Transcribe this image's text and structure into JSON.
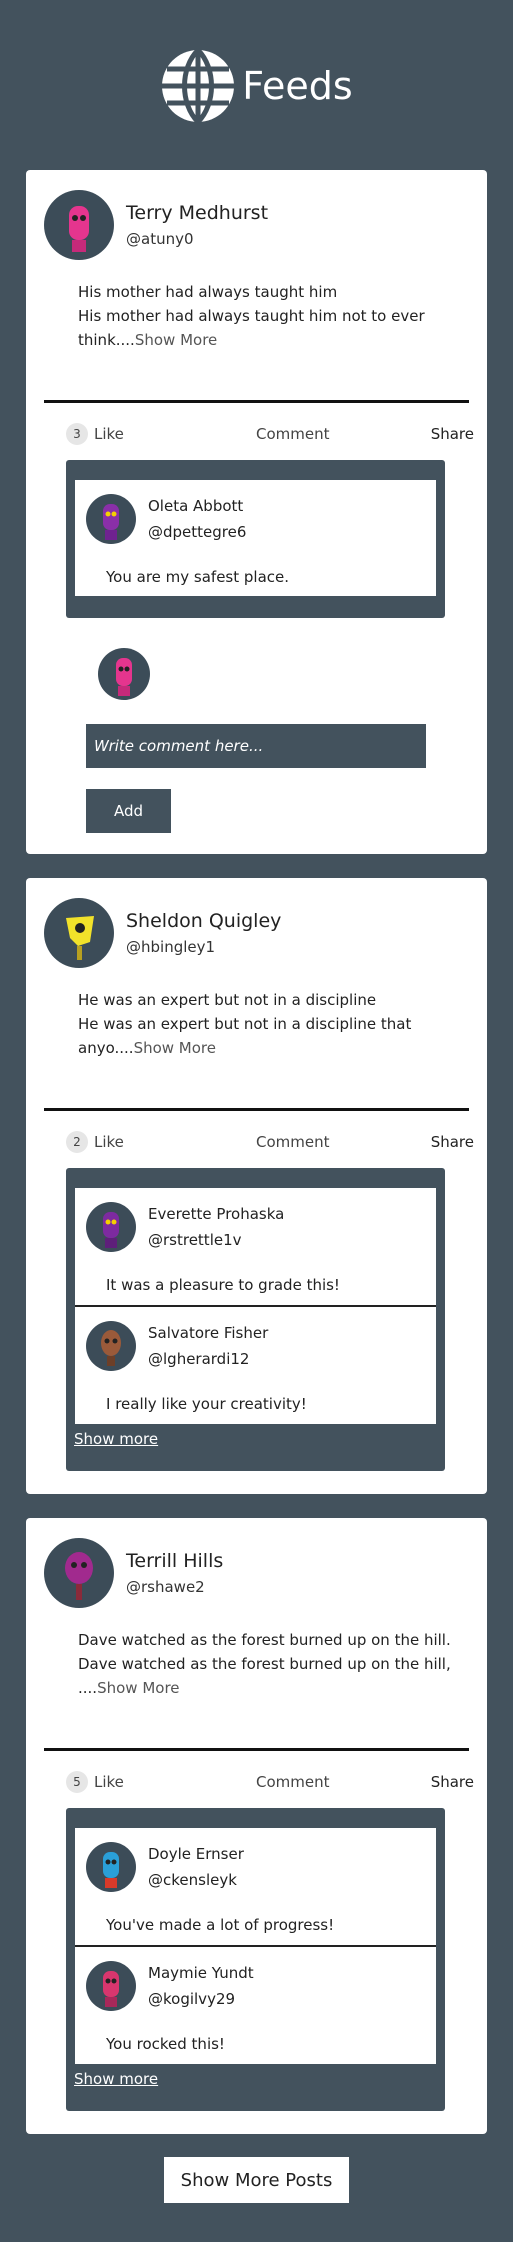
{
  "header": {
    "title": "Feeds",
    "icon": "globe-icon"
  },
  "posts": [
    {
      "author": {
        "name": "Terry Medhurst",
        "handle": "@atuny0",
        "avatar_color": "#e5358e"
      },
      "text_line1": "His mother had always taught him",
      "text_line2": "His mother had always taught him not to ever",
      "text_line3": "think....",
      "show_more": "Show More",
      "likes": "3",
      "like_label": "Like",
      "comment_label": "Comment",
      "share_label": "Share",
      "comments": [
        {
          "name": "Oleta Abbott",
          "handle": "@dpettegre6",
          "text": "You are my safest place.",
          "avatar_color": "#8a2fa8"
        }
      ],
      "comment_placeholder": "Write comment here...",
      "add_label": "Add"
    },
    {
      "author": {
        "name": "Sheldon Quigley",
        "handle": "@hbingley1",
        "avatar_color": "#f2e22a"
      },
      "text_line1": "He was an expert but not in a discipline",
      "text_line2": "He was an expert but not in a discipline that",
      "text_line3": "anyo....",
      "show_more": "Show More",
      "likes": "2",
      "like_label": "Like",
      "comment_label": "Comment",
      "share_label": "Share",
      "comments": [
        {
          "name": "Everette Prohaska",
          "handle": "@rstrettle1v",
          "text": "It was a pleasure to grade this!",
          "avatar_color": "#7d2aa0"
        },
        {
          "name": "Salvatore Fisher",
          "handle": "@lgherardi12",
          "text": "I really like your creativity!",
          "avatar_color": "#9a5a3a"
        }
      ],
      "comments_show_more": "Show more"
    },
    {
      "author": {
        "name": "Terrill Hills",
        "handle": "@rshawe2",
        "avatar_color": "#a12a8e"
      },
      "text_line1": "Dave watched as the forest burned up on the hill.",
      "text_line2": "Dave watched as the forest burned up on the hill,",
      "text_line3": "....",
      "show_more": "Show More",
      "likes": "5",
      "like_label": "Like",
      "comment_label": "Comment",
      "share_label": "Share",
      "comments": [
        {
          "name": "Doyle Ernser",
          "handle": "@ckensleyk",
          "text": "You've made a lot of progress!",
          "avatar_color": "#2a9fd8"
        },
        {
          "name": "Maymie Yundt",
          "handle": "@kogilvy29",
          "text": "You rocked this!",
          "avatar_color": "#d8366e"
        }
      ],
      "comments_show_more": "Show more"
    }
  ],
  "show_more_posts": "Show More Posts"
}
